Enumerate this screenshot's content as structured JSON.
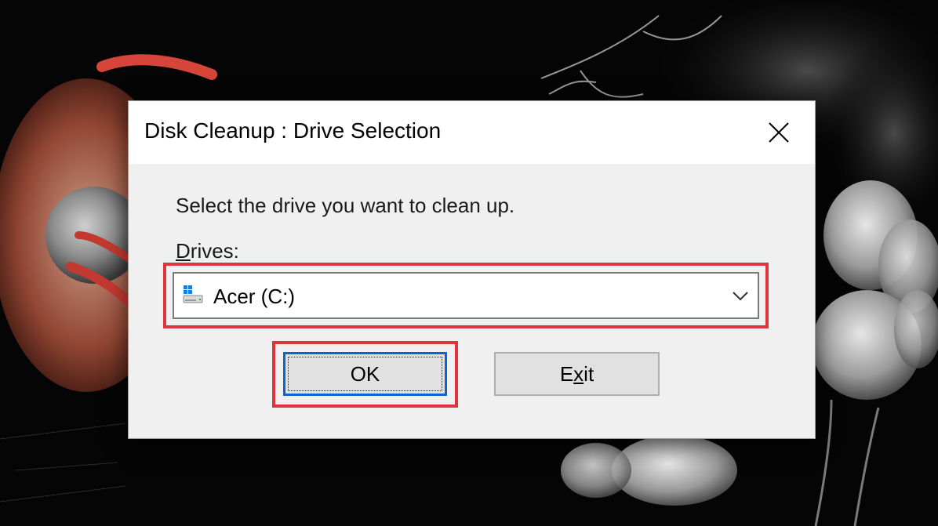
{
  "dialog": {
    "title": "Disk Cleanup : Drive Selection",
    "close_icon": "close-icon",
    "instruction": "Select the drive you want to clean up.",
    "drives_label": {
      "accesskey": "D",
      "rest": "rives:"
    },
    "drive_select": {
      "selected": "Acer (C:)",
      "icon": "drive-icon",
      "arrow_icon": "chevron-down-icon"
    },
    "buttons": {
      "ok": "OK",
      "exit": {
        "before": "E",
        "accesskey": "x",
        "after": "it"
      }
    }
  },
  "colors": {
    "highlight": "#e0343c",
    "focus_border": "#0a64d2",
    "dialog_bg": "#f0f0f0",
    "titlebar_bg": "#ffffff"
  }
}
